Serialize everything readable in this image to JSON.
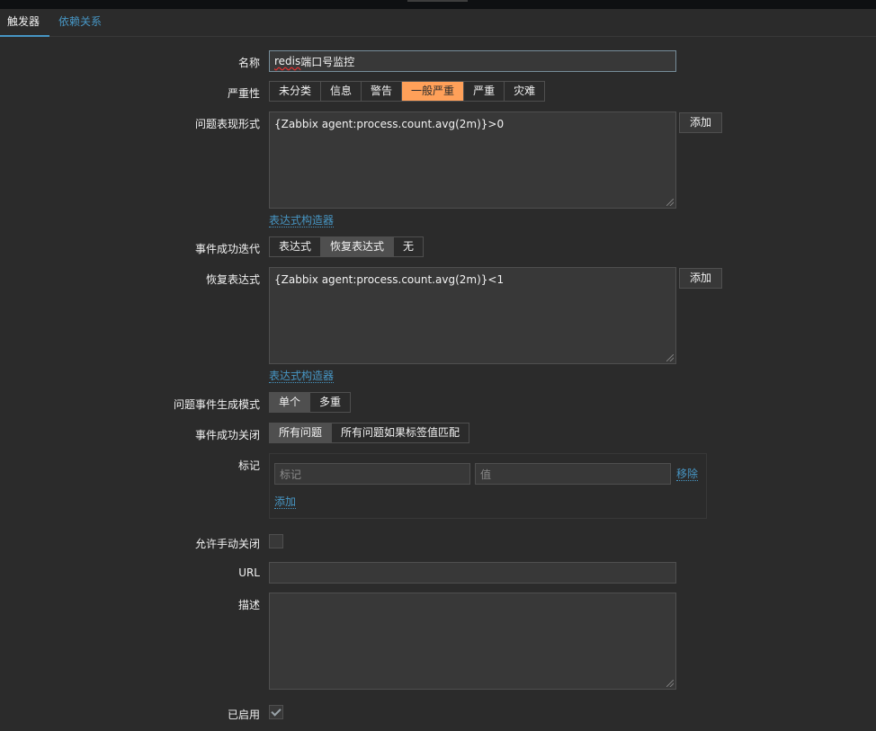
{
  "tabs": [
    {
      "label": "触发器"
    },
    {
      "label": "依赖关系"
    }
  ],
  "form": {
    "name": {
      "label": "名称",
      "value_spell": "redis",
      "value_rest": " 端口号监控"
    },
    "severity": {
      "label": "严重性",
      "options": [
        "未分类",
        "信息",
        "警告",
        "一般严重",
        "严重",
        "灾难"
      ],
      "selected": "一般严重"
    },
    "problem_expression": {
      "label": "问题表现形式",
      "value": "{Zabbix agent:process.count.avg(2m)}>0",
      "add_label": "添加",
      "builder_link": "表达式构造器"
    },
    "ok_event_generation": {
      "label": "事件成功迭代",
      "options": [
        "表达式",
        "恢复表达式",
        "无"
      ],
      "selected": "恢复表达式"
    },
    "recovery_expression": {
      "label": "恢复表达式",
      "value": "{Zabbix agent:process.count.avg(2m)}<1",
      "add_label": "添加",
      "builder_link": "表达式构造器"
    },
    "problem_event_mode": {
      "label": "问题事件生成模式",
      "options": [
        "单个",
        "多重"
      ],
      "selected": "单个"
    },
    "ok_event_closes": {
      "label": "事件成功关闭",
      "options": [
        "所有问题",
        "所有问题如果标签值匹配"
      ],
      "selected": "所有问题"
    },
    "tags": {
      "label": "标记",
      "tag_placeholder": "标记",
      "value_placeholder": "值",
      "remove_label": "移除",
      "add_label": "添加"
    },
    "manual_close": {
      "label": "允许手动关闭",
      "checked": false
    },
    "url": {
      "label": "URL",
      "value": ""
    },
    "description": {
      "label": "描述",
      "value": ""
    },
    "enabled": {
      "label": "已启用",
      "checked": true
    }
  },
  "colors": {
    "background": "#2b2b2b",
    "accent_link": "#4796c4",
    "severity_average": "#ffa059"
  }
}
